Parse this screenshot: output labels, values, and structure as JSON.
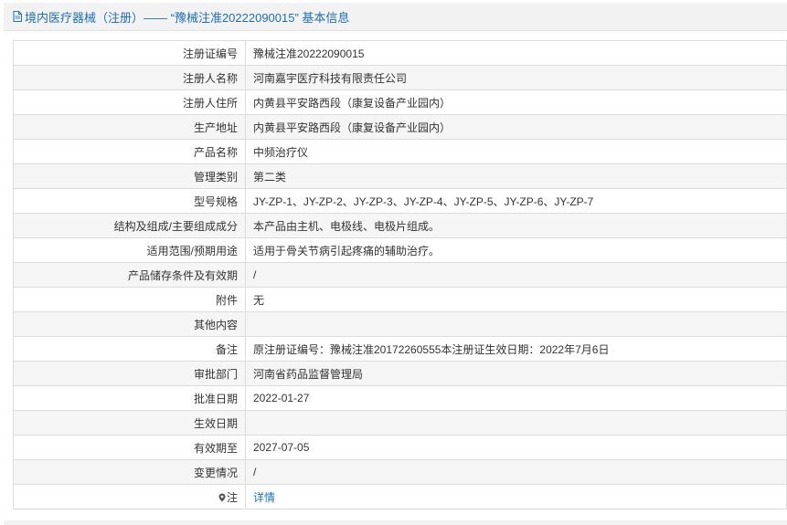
{
  "header": {
    "title": "境内医疗器械（注册）—— “豫械注准20222090015” 基本信息"
  },
  "rows": [
    {
      "label": "注册证编号",
      "value": "豫械注准20222090015"
    },
    {
      "label": "注册人名称",
      "value": "河南嘉宇医疗科技有限责任公司"
    },
    {
      "label": "注册人住所",
      "value": "内黄县平安路西段（康复设备产业园内）"
    },
    {
      "label": "生产地址",
      "value": "内黄县平安路西段（康复设备产业园内）"
    },
    {
      "label": "产品名称",
      "value": "中频治疗仪"
    },
    {
      "label": "管理类别",
      "value": "第二类"
    },
    {
      "label": "型号规格",
      "value": "JY-ZP-1、JY-ZP-2、JY-ZP-3、JY-ZP-4、JY-ZP-5、JY-ZP-6、JY-ZP-7"
    },
    {
      "label": "结构及组成/主要组成成分",
      "value": "本产品由主机、电极线、电极片组成。"
    },
    {
      "label": "适用范围/预期用途",
      "value": "适用于骨关节病引起疼痛的辅助治疗。"
    },
    {
      "label": "产品储存条件及有效期",
      "value": "/"
    },
    {
      "label": "附件",
      "value": "无"
    },
    {
      "label": "其他内容",
      "value": ""
    },
    {
      "label": "备注",
      "value": "原注册证编号：豫械注准20172260555本注册证生效日期：2022年7月6日"
    },
    {
      "label": "审批部门",
      "value": "河南省药品监督管理局"
    },
    {
      "label": "批准日期",
      "value": "2022-01-27"
    },
    {
      "label": "生效日期",
      "value": ""
    },
    {
      "label": "有效期至",
      "value": "2027-07-05"
    },
    {
      "label": "变更情况",
      "value": "/"
    }
  ],
  "note": {
    "label": "注",
    "icon": "pin-icon",
    "link_text": "详情"
  },
  "colors": {
    "link": "#1e6fb8",
    "header_bg": "#f2f2f2",
    "row_alt_bg": "#f5f5f5",
    "border": "#dcdcdc"
  }
}
